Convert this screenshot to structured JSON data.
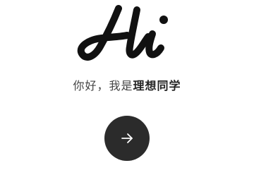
{
  "logo": {
    "text": "Hi"
  },
  "greeting": {
    "prefix": "你好，我是",
    "name": "理想同学"
  },
  "next_button": {
    "icon": "arrow-right-icon"
  },
  "colors": {
    "background": "#ffffff",
    "button": "#2b2b2b",
    "text": "#444444",
    "name_text": "#222222"
  }
}
